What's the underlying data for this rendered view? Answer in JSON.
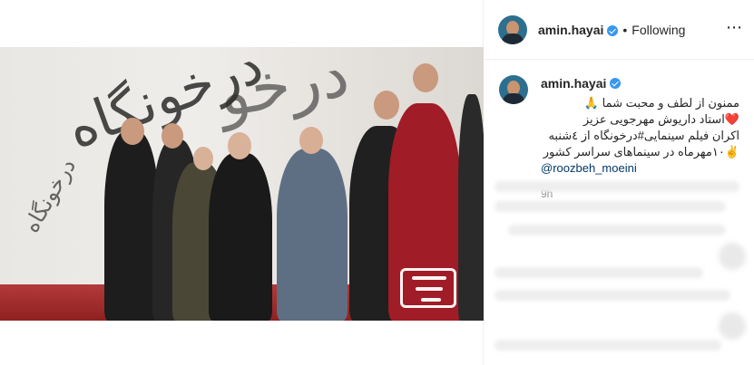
{
  "header": {
    "username": "amin.hayai",
    "separator": "•",
    "follow_status": "Following",
    "more_icon": "⋯"
  },
  "caption": {
    "username": "amin.hayai",
    "text": "ممنون از لطف و محبت شما 🙏\n❤️استاد داریوش مهرجویی عزیز\nاکران فیلم سینمایی#درخونگاه از ٤شنبه\n✌️۱۰مهرماه در سینماهای سراسر کشور",
    "mention": "@roozbeh_moeini",
    "time": "9h"
  },
  "icons": {
    "verified": "verified-badge-icon",
    "more": "more-options-icon"
  },
  "colors": {
    "verified": "#3897f0",
    "mention": "#00376b",
    "muted": "#8e8e8e"
  }
}
